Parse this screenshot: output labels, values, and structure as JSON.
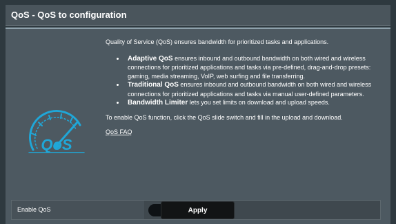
{
  "header": {
    "title": "QoS - QoS to configuration"
  },
  "logo": {
    "text": "QoS",
    "color": "#1fa7d8"
  },
  "description": {
    "intro": "Quality of Service (QoS) ensures bandwidth for prioritized tasks and applications.",
    "features": [
      {
        "title": "Adaptive QoS",
        "text": " ensures inbound and outbound bandwidth on both wired and wireless connections for prioritized applications and tasks via pre-defined, drag-and-drop presets: gaming, media streaming, VoIP, web surfing and file transferring."
      },
      {
        "title": "Traditional QoS",
        "text": " ensures inbound and outbound bandwidth on both wired and wireless connections for prioritized applications and tasks via manual user-defined parameters."
      },
      {
        "title": "Bandwidth Limiter",
        "text": " lets you set limits on download and upload speeds."
      }
    ],
    "instruction": "To enable QoS function, click the QoS slide switch and fill in the upload and download.",
    "faq_link": "QoS FAQ"
  },
  "enable_qos": {
    "label": "Enable QoS",
    "state": "OFF"
  },
  "apply_button": {
    "label": "Apply"
  }
}
